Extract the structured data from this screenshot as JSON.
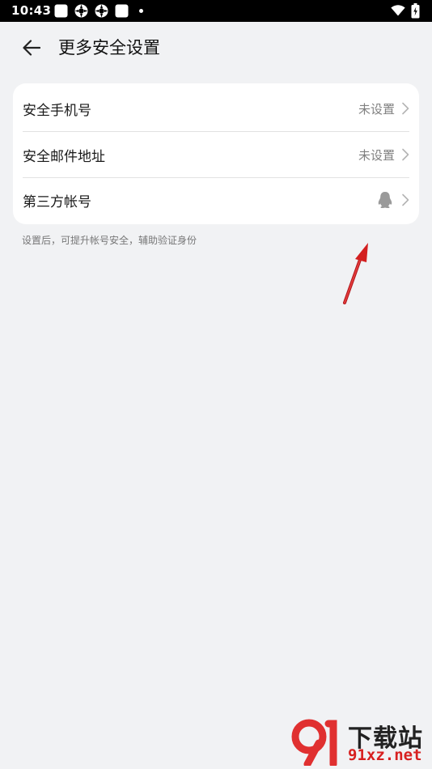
{
  "status_bar": {
    "time": "10:43",
    "icons": [
      "app-icon",
      "settings-like-icon",
      "settings-like-icon",
      "app-icon",
      "dot-icon",
      "wifi-icon",
      "battery-icon"
    ]
  },
  "header": {
    "back_icon": "arrow-left-icon",
    "title": "更多安全设置"
  },
  "settings": {
    "items": [
      {
        "label": "安全手机号",
        "value": "未设置"
      },
      {
        "label": "安全邮件地址",
        "value": "未设置"
      },
      {
        "label": "第三方帐号",
        "value": "",
        "icon": "qq-icon"
      }
    ]
  },
  "hint": "设置后，可提升帐号安全，辅助验证身份",
  "watermark": {
    "title": "下载站",
    "url": "91xz.net"
  },
  "colors": {
    "background": "#f1f2f4",
    "card": "#ffffff",
    "secondary_text": "#808080",
    "annotation_arrow": "#d31f1f"
  }
}
